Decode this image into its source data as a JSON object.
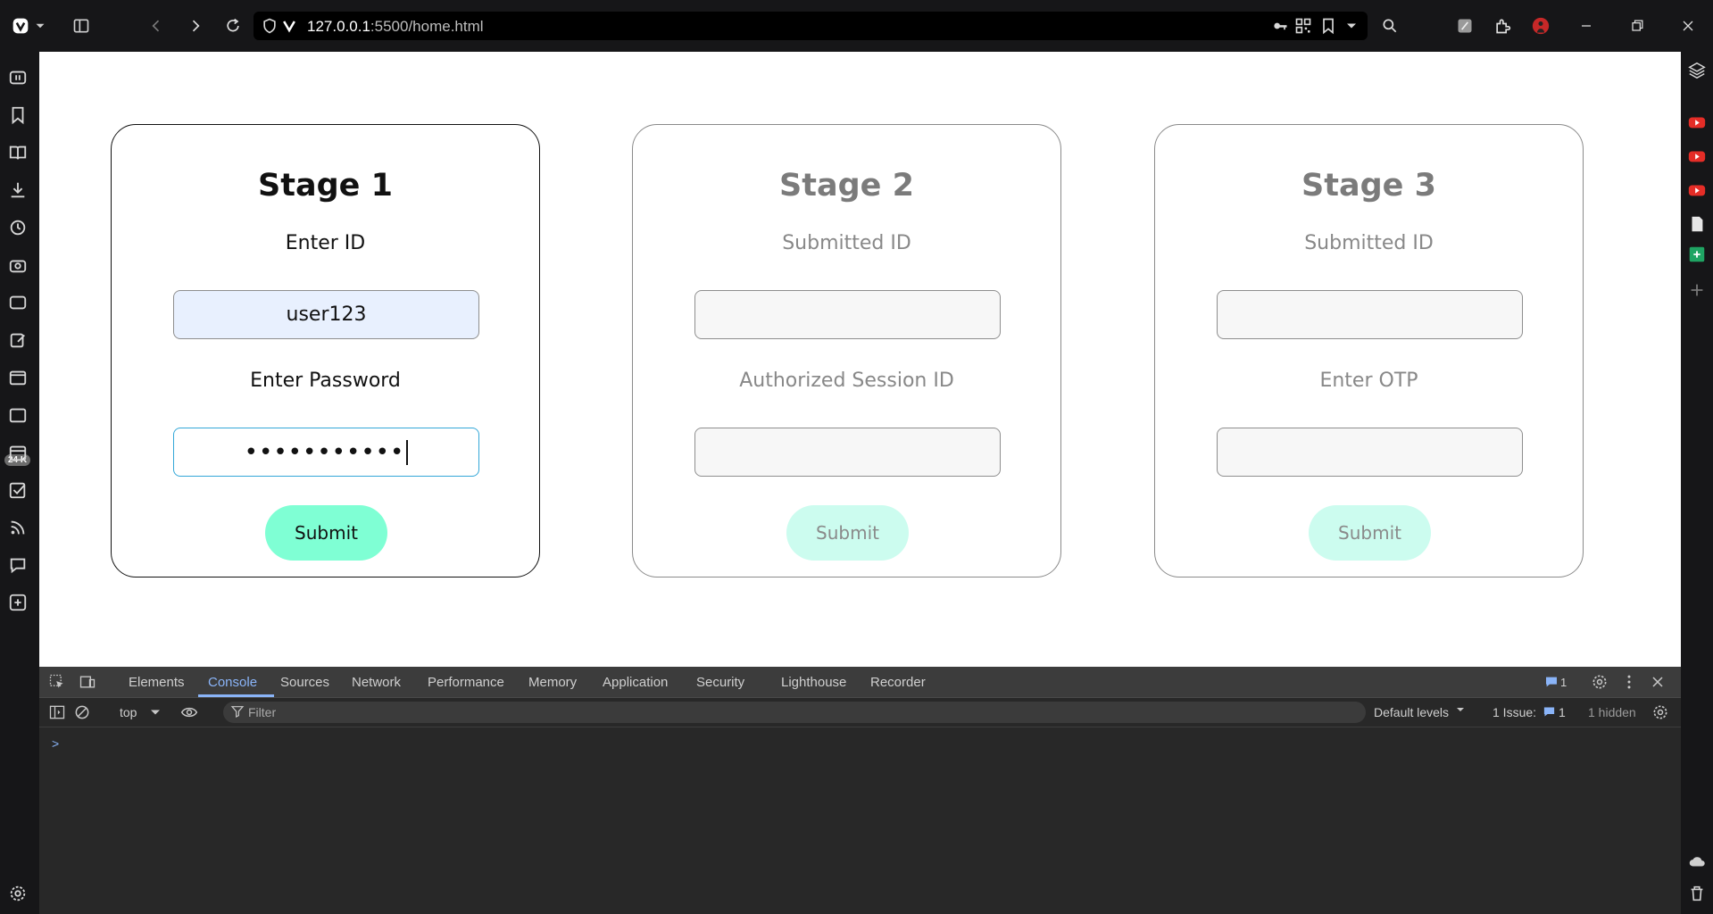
{
  "browser": {
    "url_host": "127.0.0.1",
    "url_path": ":5500/home.html"
  },
  "left_panel": {
    "badge": "24 K"
  },
  "stages": [
    {
      "title": "Stage 1",
      "field1_label": "Enter ID",
      "field1_value": "user123",
      "field2_label": "Enter Password",
      "field2_value": "•••••••••••",
      "button": "Submit"
    },
    {
      "title": "Stage 2",
      "field1_label": "Submitted ID",
      "field1_value": "",
      "field2_label": "Authorized Session ID",
      "field2_value": "",
      "button": "Submit"
    },
    {
      "title": "Stage 3",
      "field1_label": "Submitted ID",
      "field1_value": "",
      "field2_label": "Enter OTP",
      "field2_value": "",
      "button": "Submit"
    }
  ],
  "devtools": {
    "tabs": [
      "Elements",
      "Console",
      "Sources",
      "Network",
      "Performance",
      "Memory",
      "Application",
      "Security",
      "Lighthouse",
      "Recorder"
    ],
    "active_tab": "Console",
    "issue_count_badge": "1",
    "context": "top",
    "filter_placeholder": "Filter",
    "levels": "Default levels",
    "issues_label": "1 Issue:",
    "issues_count": "1",
    "hidden": "1 hidden",
    "prompt": ">"
  },
  "colors": {
    "accent_button": "#7fffd4",
    "focus_border": "#33a7d8",
    "devtools_accent": "#8ab4f8"
  }
}
